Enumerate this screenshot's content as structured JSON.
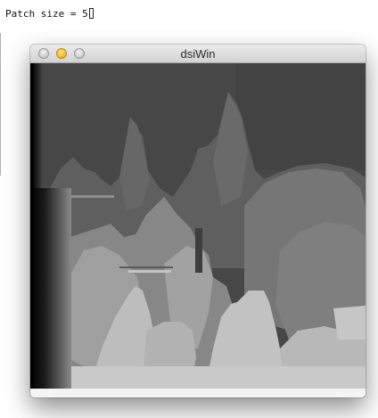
{
  "console": {
    "text": "Patch size = 5"
  },
  "window": {
    "title": "dsiWin",
    "buttons": [
      "close",
      "minimize",
      "zoom"
    ]
  },
  "image": {
    "description_name": "disparity-map",
    "colors": {
      "background_dark": "#4a4a4a",
      "foreground_light": "#c8c8c8",
      "left_edge": "#000000"
    }
  }
}
